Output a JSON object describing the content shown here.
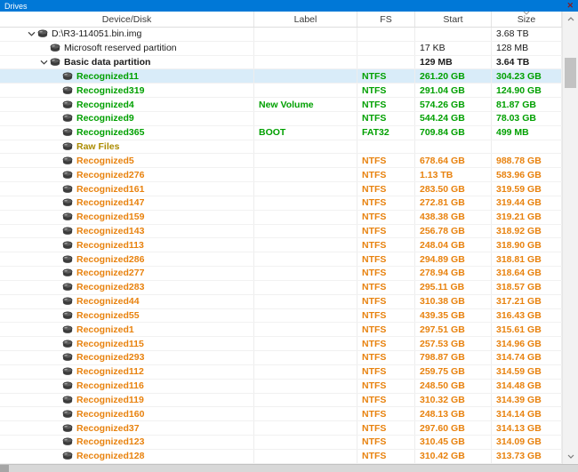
{
  "panel": {
    "title": "Drives",
    "close_glyph": "✕"
  },
  "colors": {
    "accent_blue": "#0078d7",
    "selected_row": "#d9ecf9",
    "text_black": "#1b1b1b",
    "text_green": "#00a000",
    "text_orange": "#e8820e",
    "text_olive": "#ab8b00"
  },
  "table": {
    "columns": [
      {
        "key": "device",
        "label": "Device/Disk"
      },
      {
        "key": "label",
        "label": "Label"
      },
      {
        "key": "fs",
        "label": "FS"
      },
      {
        "key": "start",
        "label": "Start"
      },
      {
        "key": "size",
        "label": "Size"
      }
    ],
    "sort": {
      "column": "size",
      "indicator": "caret"
    },
    "rows": [
      {
        "name": "D:\\R3-114051.bin.img",
        "level": 0,
        "expanded": true,
        "label": "",
        "fs": "",
        "start": "",
        "size": "3.68 TB",
        "color": "black",
        "bold": false,
        "selected": false
      },
      {
        "name": "Microsoft reserved partition",
        "level": 1,
        "expanded": false,
        "label": "",
        "fs": "",
        "start": "17 KB",
        "size": "128 MB",
        "color": "black",
        "bold": false,
        "selected": false
      },
      {
        "name": "Basic data partition",
        "level": 1,
        "expanded": true,
        "label": "",
        "fs": "",
        "start": "129 MB",
        "size": "3.64 TB",
        "color": "black",
        "bold": true,
        "selected": false
      },
      {
        "name": "Recognized11",
        "level": 2,
        "expanded": false,
        "label": "",
        "fs": "NTFS",
        "start": "261.20 GB",
        "size": "304.23 GB",
        "color": "green",
        "bold": true,
        "selected": true
      },
      {
        "name": "Recognized319",
        "level": 2,
        "expanded": false,
        "label": "",
        "fs": "NTFS",
        "start": "291.04 GB",
        "size": "124.90 GB",
        "color": "green",
        "bold": true,
        "selected": false
      },
      {
        "name": "Recognized4",
        "level": 2,
        "expanded": false,
        "label": "New Volume",
        "fs": "NTFS",
        "start": "574.26 GB",
        "size": "81.87 GB",
        "color": "green",
        "bold": true,
        "selected": false
      },
      {
        "name": "Recognized9",
        "level": 2,
        "expanded": false,
        "label": "",
        "fs": "NTFS",
        "start": "544.24 GB",
        "size": "78.03 GB",
        "color": "green",
        "bold": true,
        "selected": false
      },
      {
        "name": "Recognized365",
        "level": 2,
        "expanded": false,
        "label": "BOOT",
        "fs": "FAT32",
        "start": "709.84 GB",
        "size": "499 MB",
        "color": "green",
        "bold": true,
        "selected": false
      },
      {
        "name": "Raw Files",
        "level": 2,
        "expanded": false,
        "label": "",
        "fs": "",
        "start": "",
        "size": "",
        "color": "olive",
        "bold": true,
        "selected": false
      },
      {
        "name": "Recognized5",
        "level": 2,
        "expanded": false,
        "label": "",
        "fs": "NTFS",
        "start": "678.64 GB",
        "size": "988.78 GB",
        "color": "orange",
        "bold": true,
        "selected": false
      },
      {
        "name": "Recognized276",
        "level": 2,
        "expanded": false,
        "label": "",
        "fs": "NTFS",
        "start": "1.13 TB",
        "size": "583.96 GB",
        "color": "orange",
        "bold": true,
        "selected": false
      },
      {
        "name": "Recognized161",
        "level": 2,
        "expanded": false,
        "label": "",
        "fs": "NTFS",
        "start": "283.50 GB",
        "size": "319.59 GB",
        "color": "orange",
        "bold": true,
        "selected": false
      },
      {
        "name": "Recognized147",
        "level": 2,
        "expanded": false,
        "label": "",
        "fs": "NTFS",
        "start": "272.81 GB",
        "size": "319.44 GB",
        "color": "orange",
        "bold": true,
        "selected": false
      },
      {
        "name": "Recognized159",
        "level": 2,
        "expanded": false,
        "label": "",
        "fs": "NTFS",
        "start": "438.38 GB",
        "size": "319.21 GB",
        "color": "orange",
        "bold": true,
        "selected": false
      },
      {
        "name": "Recognized143",
        "level": 2,
        "expanded": false,
        "label": "",
        "fs": "NTFS",
        "start": "256.78 GB",
        "size": "318.92 GB",
        "color": "orange",
        "bold": true,
        "selected": false
      },
      {
        "name": "Recognized113",
        "level": 2,
        "expanded": false,
        "label": "",
        "fs": "NTFS",
        "start": "248.04 GB",
        "size": "318.90 GB",
        "color": "orange",
        "bold": true,
        "selected": false
      },
      {
        "name": "Recognized286",
        "level": 2,
        "expanded": false,
        "label": "",
        "fs": "NTFS",
        "start": "294.89 GB",
        "size": "318.81 GB",
        "color": "orange",
        "bold": true,
        "selected": false
      },
      {
        "name": "Recognized277",
        "level": 2,
        "expanded": false,
        "label": "",
        "fs": "NTFS",
        "start": "278.94 GB",
        "size": "318.64 GB",
        "color": "orange",
        "bold": true,
        "selected": false
      },
      {
        "name": "Recognized283",
        "level": 2,
        "expanded": false,
        "label": "",
        "fs": "NTFS",
        "start": "295.11 GB",
        "size": "318.57 GB",
        "color": "orange",
        "bold": true,
        "selected": false
      },
      {
        "name": "Recognized44",
        "level": 2,
        "expanded": false,
        "label": "",
        "fs": "NTFS",
        "start": "310.38 GB",
        "size": "317.21 GB",
        "color": "orange",
        "bold": true,
        "selected": false
      },
      {
        "name": "Recognized55",
        "level": 2,
        "expanded": false,
        "label": "",
        "fs": "NTFS",
        "start": "439.35 GB",
        "size": "316.43 GB",
        "color": "orange",
        "bold": true,
        "selected": false
      },
      {
        "name": "Recognized1",
        "level": 2,
        "expanded": false,
        "label": "",
        "fs": "NTFS",
        "start": "297.51 GB",
        "size": "315.61 GB",
        "color": "orange",
        "bold": true,
        "selected": false
      },
      {
        "name": "Recognized115",
        "level": 2,
        "expanded": false,
        "label": "",
        "fs": "NTFS",
        "start": "257.53 GB",
        "size": "314.96 GB",
        "color": "orange",
        "bold": true,
        "selected": false
      },
      {
        "name": "Recognized293",
        "level": 2,
        "expanded": false,
        "label": "",
        "fs": "NTFS",
        "start": "798.87 GB",
        "size": "314.74 GB",
        "color": "orange",
        "bold": true,
        "selected": false
      },
      {
        "name": "Recognized112",
        "level": 2,
        "expanded": false,
        "label": "",
        "fs": "NTFS",
        "start": "259.75 GB",
        "size": "314.59 GB",
        "color": "orange",
        "bold": true,
        "selected": false
      },
      {
        "name": "Recognized116",
        "level": 2,
        "expanded": false,
        "label": "",
        "fs": "NTFS",
        "start": "248.50 GB",
        "size": "314.48 GB",
        "color": "orange",
        "bold": true,
        "selected": false
      },
      {
        "name": "Recognized119",
        "level": 2,
        "expanded": false,
        "label": "",
        "fs": "NTFS",
        "start": "310.32 GB",
        "size": "314.39 GB",
        "color": "orange",
        "bold": true,
        "selected": false
      },
      {
        "name": "Recognized160",
        "level": 2,
        "expanded": false,
        "label": "",
        "fs": "NTFS",
        "start": "248.13 GB",
        "size": "314.14 GB",
        "color": "orange",
        "bold": true,
        "selected": false
      },
      {
        "name": "Recognized37",
        "level": 2,
        "expanded": false,
        "label": "",
        "fs": "NTFS",
        "start": "297.60 GB",
        "size": "314.13 GB",
        "color": "orange",
        "bold": true,
        "selected": false
      },
      {
        "name": "Recognized123",
        "level": 2,
        "expanded": false,
        "label": "",
        "fs": "NTFS",
        "start": "310.45 GB",
        "size": "314.09 GB",
        "color": "orange",
        "bold": true,
        "selected": false
      },
      {
        "name": "Recognized128",
        "level": 2,
        "expanded": false,
        "label": "",
        "fs": "NTFS",
        "start": "310.42 GB",
        "size": "313.73 GB",
        "color": "orange",
        "bold": true,
        "selected": false
      }
    ]
  }
}
